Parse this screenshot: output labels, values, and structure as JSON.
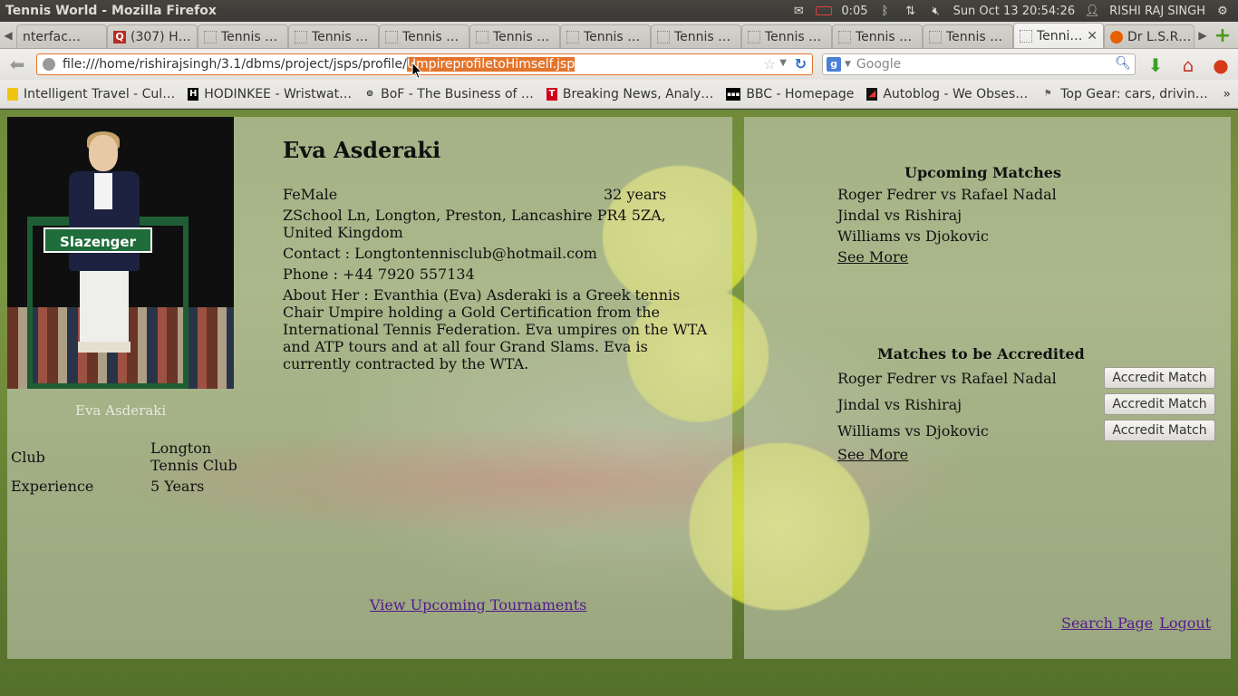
{
  "os": {
    "window_title": "Tennis World - Mozilla Firefox",
    "battery_time": "0:05",
    "datetime": "Sun Oct 13 20:54:26",
    "user": "RISHI RAJ SINGH"
  },
  "tabs": [
    {
      "label": "nterfac…",
      "icon": "blank-page-icon"
    },
    {
      "label": "(307) H…",
      "icon": "quora-icon"
    },
    {
      "label": "Tennis …",
      "icon": "blank-page-icon"
    },
    {
      "label": "Tennis …",
      "icon": "blank-page-icon"
    },
    {
      "label": "Tennis …",
      "icon": "blank-page-icon"
    },
    {
      "label": "Tennis …",
      "icon": "blank-page-icon"
    },
    {
      "label": "Tennis …",
      "icon": "blank-page-icon"
    },
    {
      "label": "Tennis …",
      "icon": "blank-page-icon"
    },
    {
      "label": "Tennis …",
      "icon": "blank-page-icon"
    },
    {
      "label": "Tennis …",
      "icon": "blank-page-icon"
    },
    {
      "label": "Tennis …",
      "icon": "blank-page-icon"
    },
    {
      "label": "Tenni…",
      "icon": "blank-page-icon",
      "active": true
    },
    {
      "label": "Dr L.S.R…",
      "icon": "firefox-icon"
    }
  ],
  "nav": {
    "url_prefix": "file:///home/rishirajsingh/3.1/dbms/project/jsps/profile/",
    "url_selected": "UmpireprofiletoHimself.jsp",
    "search_placeholder": "Google"
  },
  "bookmarks": [
    {
      "label": "Intelligent Travel - Cul…",
      "icon": "bookmark-yellow-icon",
      "color": "#f1c40f"
    },
    {
      "label": "HODINKEE - Wristwat…",
      "icon": "hodinkee-icon",
      "color": "#000000"
    },
    {
      "label": "BoF - The Business of …",
      "icon": "bof-icon",
      "color": "#333333"
    },
    {
      "label": "Breaking News, Analy…",
      "icon": "telegraph-icon",
      "color": "#d0021b"
    },
    {
      "label": "BBC - Homepage",
      "icon": "bbc-icon",
      "color": "#000000"
    },
    {
      "label": "Autoblog - We Obses…",
      "icon": "autoblog-icon",
      "color": "#111111"
    },
    {
      "label": "Top Gear: cars, drivin…",
      "icon": "topgear-icon",
      "color": "#666666"
    }
  ],
  "profile": {
    "photo_text": "Slazenger",
    "caption_name": "Eva Asderaki",
    "club_label": "Club",
    "club_value": "Longton Tennis Club",
    "experience_label": "Experience",
    "experience_value": "5 Years",
    "name": "Eva Asderaki",
    "gender": "FeMale",
    "age": "32 years",
    "address": "ZSchool Ln, Longton, Preston, Lancashire PR4 5ZA, United Kingdom",
    "contact": "Contact : Longtontennisclub@hotmail.com",
    "phone": "Phone : +44 7920 557134",
    "about": "About Her : Evanthia (Eva) Asderaki is a Greek tennis Chair Umpire holding a Gold Certification from the International Tennis Federation. Eva umpires on the WTA and ATP tours and at all four Grand Slams. Eva is currently contracted by the WTA.",
    "tournaments_link": "View Upcoming Tournaments"
  },
  "upcoming": {
    "title": "Upcoming Matches",
    "matches": [
      "Roger Fedrer vs Rafael Nadal",
      "Jindal vs Rishiraj",
      "Williams vs Djokovic"
    ],
    "see_more": "See More"
  },
  "accredit": {
    "title": "Matches to be Accredited",
    "matches": [
      "Roger Fedrer vs Rafael Nadal",
      "Jindal vs Rishiraj",
      "Williams vs Djokovic"
    ],
    "button_label": "Accredit Match",
    "see_more": "See More"
  },
  "footer": {
    "search_page": "Search Page",
    "logout": "Logout"
  }
}
